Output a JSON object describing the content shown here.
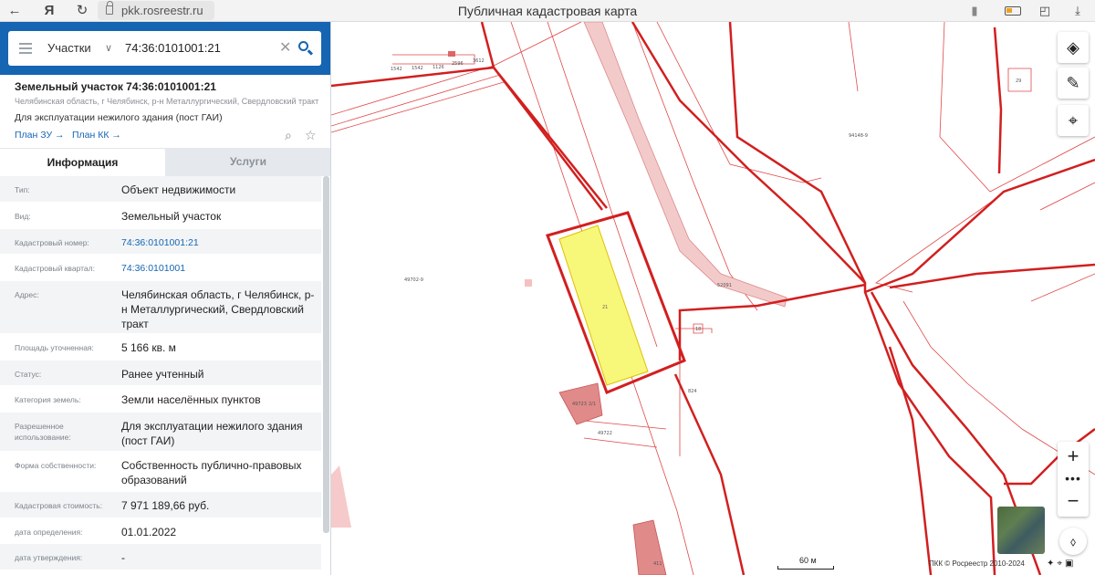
{
  "browser": {
    "url": "pkk.rosreestr.ru",
    "page_title": "Публичная кадастровая карта",
    "yandex_glyph": "Я"
  },
  "search": {
    "dropdown_label": "Участки",
    "query": "74:36:0101001:21"
  },
  "object": {
    "title": "Земельный участок 74:36:0101001:21",
    "address_line": "Челябинская область, г Челябинск, р-н Металлургический, Свердловский тракт",
    "purpose": "Для эксплуатации нежилого здания (пост ГАИ)",
    "plan_zu": "План ЗУ →",
    "plan_kk": "План КК →"
  },
  "tabs": {
    "info": "Информация",
    "services": "Услуги"
  },
  "info_rows": [
    {
      "label": "Тип:",
      "value": "Объект недвижимости"
    },
    {
      "label": "Вид:",
      "value": "Земельный участок"
    },
    {
      "label": "Кадастровый номер:",
      "value": "74:36:0101001:21"
    },
    {
      "label": "Кадастровый квартал:",
      "value": "74:36:0101001"
    },
    {
      "label": "Адрес:",
      "value": "Челябинская область, г Челябинск, р-н Металлургический, Свердловский тракт"
    },
    {
      "label": "Площадь уточненная:",
      "value": "5 166 кв. м"
    },
    {
      "label": "Статус:",
      "value": "Ранее учтенный"
    },
    {
      "label": "Категория земель:",
      "value": "Земли населённых пунктов"
    },
    {
      "label": "Разрешенное использование:",
      "value": "Для эксплуатации нежилого здания (пост ГАИ)"
    },
    {
      "label": "Форма собственности:",
      "value": "Собственность публично-правовых образований"
    },
    {
      "label": "Кадастровая стоимость:",
      "value": "7 971 189,66 руб."
    },
    {
      "label": "дата определения:",
      "value": "01.01.2022"
    },
    {
      "label": "дата утверждения:",
      "value": "-"
    }
  ],
  "map": {
    "parcel_label": "21",
    "scale_label": "60 м",
    "copyright": "ПКК © Росреестр 2010-2024",
    "parcel_color": "#f7f77a",
    "boundary_color": "#d21f1f",
    "arrow_color": "#f2d640",
    "small_labels": [
      "1542",
      "1542",
      "1126",
      "2596",
      "3612",
      "29",
      "94148-9",
      "49702-9",
      "824",
      "18",
      "49723",
      "2/1",
      "49722",
      "411",
      "52091"
    ]
  }
}
